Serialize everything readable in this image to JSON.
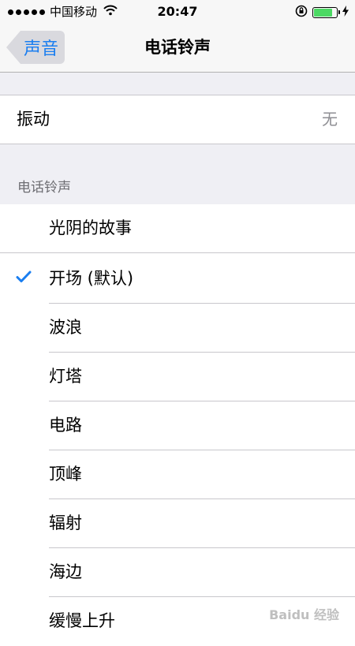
{
  "status_bar": {
    "carrier": "中国移动",
    "time": "20:47",
    "battery_level": 0.9,
    "icons": [
      "signal-dots-icon",
      "wifi-icon",
      "rotation-lock-icon",
      "battery-icon",
      "charging-icon"
    ]
  },
  "nav": {
    "back_label": "声音",
    "title": "电话铃声"
  },
  "vibration": {
    "label": "振动",
    "value": "无"
  },
  "ringtones": {
    "section_title": "电话铃声",
    "items": [
      {
        "label": "光阴的故事",
        "checked": false
      },
      {
        "label": "开场 (默认)",
        "checked": true
      },
      {
        "label": "波浪",
        "checked": false
      },
      {
        "label": "灯塔",
        "checked": false
      },
      {
        "label": "电路",
        "checked": false
      },
      {
        "label": "顶峰",
        "checked": false
      },
      {
        "label": "辐射",
        "checked": false
      },
      {
        "label": "海边",
        "checked": false
      },
      {
        "label": "缓慢上升",
        "checked": false
      }
    ]
  },
  "watermark": "Baidu 经验",
  "colors": {
    "accent": "#1a7ef0",
    "battery": "#4cd964",
    "background": "#efeff4"
  }
}
